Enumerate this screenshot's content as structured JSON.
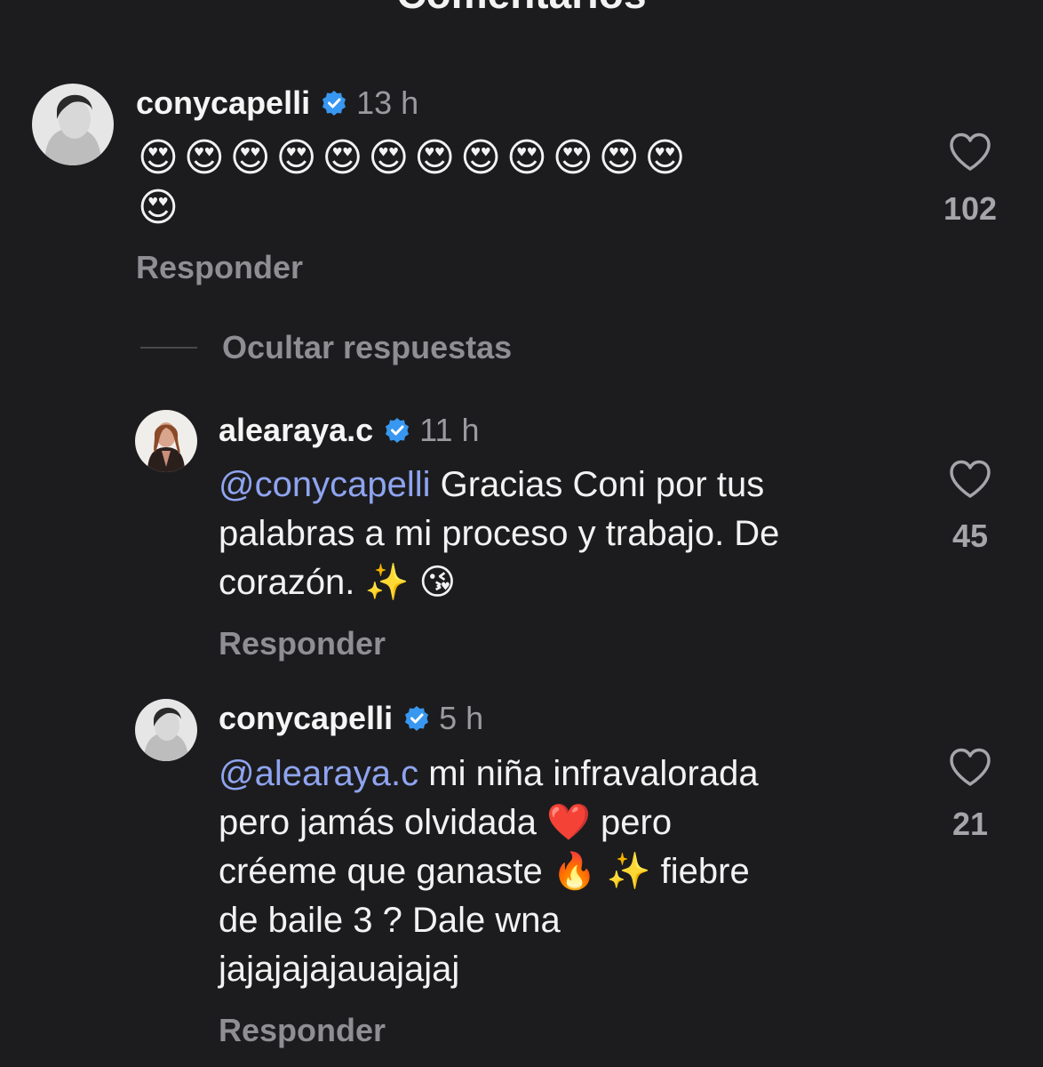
{
  "header": {
    "title": "Comentarios"
  },
  "hide_replies_label": "Ocultar respuestas",
  "comments": [
    {
      "username": "conycapelli",
      "verified": true,
      "time": "13 h",
      "text_line1": "😍😍😍😍😍😍😍😍😍😍😍😍",
      "text_line2": "😍",
      "likes": "102",
      "reply_label": "Responder"
    }
  ],
  "replies": [
    {
      "username": "alearaya.c",
      "verified": true,
      "time": "11 h",
      "mention": "@conycapelli",
      "line1_rest": " Gracias Coni por tus",
      "line2": "palabras a mi proceso y trabajo. De",
      "line3": "corazón.  ✨ 😘",
      "likes": "45",
      "reply_label": "Responder"
    },
    {
      "username": "conycapelli",
      "verified": true,
      "time": "5 h",
      "mention": "@alearaya.c",
      "line1_rest": " mi niña infravalorada",
      "line2": "pero jamás olvidada ❤️  pero",
      "line3": "créeme que ganaste 🔥 ✨  fiebre",
      "line4": "de baile 3 ? Dale wna",
      "line5": "jajajajajauajajaj",
      "likes": "21",
      "reply_label": "Responder"
    }
  ],
  "colors": {
    "background": "#1c1c1e",
    "verified_badge": "#3897f0",
    "mention": "#8fa4f0",
    "muted": "#8e8e93"
  },
  "icons": {
    "like": "heart-outline-icon",
    "verified": "verified-badge-icon"
  }
}
